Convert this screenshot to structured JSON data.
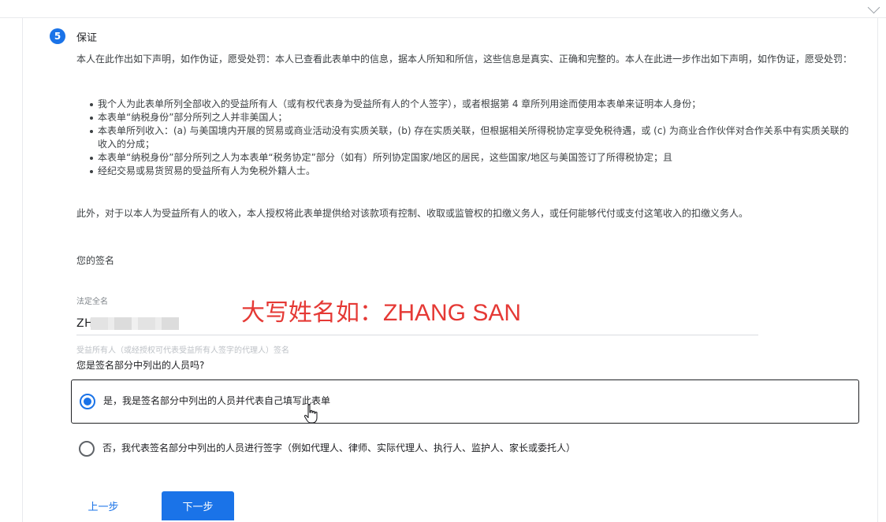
{
  "section": {
    "number": "5",
    "title": "保证"
  },
  "declaration": {
    "intro": "本人在此作出如下声明，如作伪证，愿受处罚：本人已查看此表单中的信息，据本人所知和所信，这些信息是真实、正确和完整的。本人在此进一步作出如下声明，如作伪证，愿受处罚：",
    "bullets": [
      "我个人为此表单所列全部收入的受益所有人（或有权代表身为受益所有人的个人签字），或者根据第 4 章所列用途而使用本表单来证明本人身份；",
      "本表单“纳税身份”部分所列之人并非美国人；",
      "本表单所列收入：(a) 与美国境内开展的贸易或商业活动没有实质关联，(b) 存在实质关联，但根据相关所得税协定享受免税待遇，或 (c) 为商业合作伙伴对合作关系中有实质关联的收入的分成；",
      "本表单“纳税身份”部分所列之人为本表单“税务协定”部分（如有）所列协定国家/地区的居民，这些国家/地区与美国签订了所得税协定；且",
      "经纪交易或易货贸易的受益所有人为免税外籍人士。"
    ],
    "authorization": "此外，对于以本人为受益所有人的收入，本人授权将此表单提供给对该款项有控制、收取或监管权的扣缴义务人，或任何能够代付或支付这笔收入的扣缴义务人。"
  },
  "signature": {
    "heading": "您的签名",
    "legal_name_label": "法定全名",
    "legal_name_value": "ZH          G",
    "annotation": "大写姓名如：ZHANG SAN",
    "helper_text": "受益所有人（或经授权可代表受益所有人签字的代理人）签名"
  },
  "question": {
    "text": "您是签名部分中列出的人员吗?",
    "options": [
      {
        "label": "是，我是签名部分中列出的人员并代表自己填写此表单",
        "selected": true
      },
      {
        "label": "否，我代表签名部分中列出的人员进行签字（例如代理人、律师、实际代理人、执行人、监护人、家长或委托人）",
        "selected": false
      }
    ]
  },
  "nav": {
    "prev_label": "上一步",
    "next_label": "下一步"
  },
  "colors": {
    "accent": "#1a73e8",
    "annotation": "#e53935"
  },
  "icons": {
    "cursor": "hand-pointer-icon"
  }
}
